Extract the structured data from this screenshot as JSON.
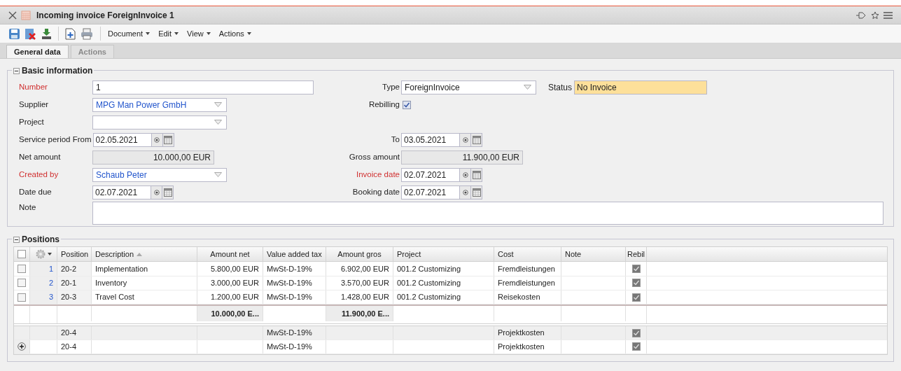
{
  "window": {
    "title": "Incoming invoice ForeignInvoice 1"
  },
  "menus": [
    "Document",
    "Edit",
    "View",
    "Actions"
  ],
  "tabs": [
    {
      "label": "General data",
      "selected": true
    },
    {
      "label": "Actions",
      "selected": false
    }
  ],
  "basic": {
    "title": "Basic information",
    "rows": [
      {
        "left": {
          "label": "Number",
          "required": true,
          "kind": "text",
          "value": "1"
        },
        "right": {
          "label": "Type",
          "required": false,
          "kind": "select",
          "value": "ForeignInvoice"
        },
        "status": {
          "label": "Status",
          "value": "No Invoice"
        }
      },
      {
        "left": {
          "label": "Supplier",
          "required": false,
          "kind": "select",
          "value": "MPG Man Power GmbH"
        },
        "right": {
          "label": "Rebilling",
          "required": false,
          "kind": "checkbox",
          "checked": true
        }
      },
      {
        "left": {
          "label": "Project",
          "required": false,
          "kind": "select"
        }
      },
      {
        "left": {
          "label": "Service period From",
          "required": false,
          "kind": "date",
          "value": "02.05.2021"
        },
        "right": {
          "label": "To",
          "required": false,
          "kind": "date",
          "value": "03.05.2021"
        }
      },
      {
        "left": {
          "label": "Net amount",
          "required": false,
          "kind": "amount",
          "value": "10.000,00 EUR"
        },
        "right": {
          "label": "Gross amount",
          "required": false,
          "kind": "amount",
          "value": "11.900,00 EUR"
        }
      },
      {
        "left": {
          "label": "Created by",
          "required": true,
          "kind": "select",
          "value": "Schaub Peter"
        },
        "right": {
          "label": "Invoice date",
          "required": true,
          "kind": "date",
          "value": "02.07.2021"
        }
      },
      {
        "left": {
          "label": "Date due",
          "required": false,
          "kind": "date",
          "value": "02.07.2021"
        },
        "right": {
          "label": "Booking date",
          "required": false,
          "kind": "date",
          "value": "02.07.2021"
        }
      },
      {
        "left": {
          "label": "Note",
          "required": false,
          "kind": "textarea"
        }
      }
    ]
  },
  "positions": {
    "title": "Positions",
    "all_checked": false,
    "columns": [
      {
        "label": "Position"
      },
      {
        "label": "Description",
        "sorted": true
      },
      {
        "label": "Amount net"
      },
      {
        "label": "Value added tax"
      },
      {
        "label": "Amount gros"
      },
      {
        "label": "Project"
      },
      {
        "label": "Cost"
      },
      {
        "label": "Note"
      },
      {
        "label": "Rebil"
      }
    ],
    "rows": [
      {
        "kind": "item",
        "index": "1",
        "checked": false,
        "cells": [
          "20-2",
          "Implementation",
          "5.800,00 EUR",
          "MwSt-D-19%",
          "6.902,00 EUR",
          "001.2 Customizing",
          "Fremdleistungen",
          ""
        ],
        "rebilling": true
      },
      {
        "kind": "item",
        "index": "2",
        "checked": false,
        "cells": [
          "20-1",
          "Inventory",
          "3.000,00 EUR",
          "MwSt-D-19%",
          "3.570,00 EUR",
          "001.2 Customizing",
          "Fremdleistungen",
          ""
        ],
        "rebilling": true
      },
      {
        "kind": "item",
        "index": "3",
        "checked": false,
        "cells": [
          "20-3",
          "Travel Cost",
          "1.200,00 EUR",
          "MwSt-D-19%",
          "1.428,00 EUR",
          "001.2 Customizing",
          "Reisekosten",
          ""
        ],
        "rebilling": true
      },
      {
        "kind": "total",
        "cells": [
          "",
          "",
          "10.000,00 E...",
          "",
          "11.900,00 E...",
          "",
          "",
          ""
        ]
      },
      {
        "kind": "template",
        "cells": [
          "20-4",
          "",
          "",
          "MwSt-D-19%",
          "",
          "",
          "Projektkosten",
          ""
        ],
        "rebilling": true
      },
      {
        "kind": "new",
        "cells": [
          "20-4",
          "",
          "",
          "MwSt-D-19%",
          "",
          "",
          "Projektkosten",
          ""
        ],
        "rebilling": true
      }
    ]
  }
}
